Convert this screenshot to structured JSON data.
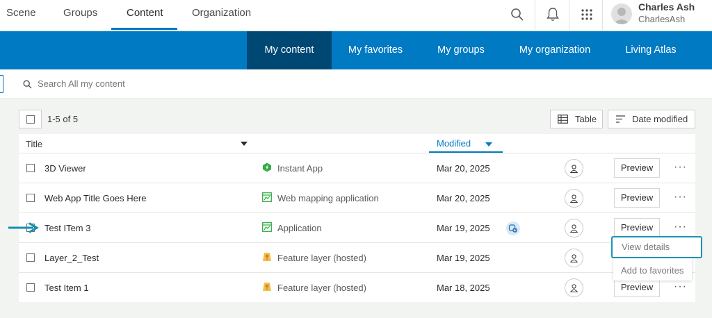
{
  "top_nav": {
    "tabs": [
      {
        "label": "Scene",
        "active": false
      },
      {
        "label": "Groups",
        "active": false
      },
      {
        "label": "Content",
        "active": true
      },
      {
        "label": "Organization",
        "active": false
      }
    ],
    "user": {
      "name": "Charles Ash",
      "username": "CharlesAsh"
    },
    "icons": [
      "search-icon",
      "bell-icon",
      "app-launcher-icon"
    ]
  },
  "content_nav": {
    "tabs": [
      {
        "label": "My content",
        "active": true
      },
      {
        "label": "My favorites",
        "active": false
      },
      {
        "label": "My groups",
        "active": false
      },
      {
        "label": "My organization",
        "active": false
      },
      {
        "label": "Living Atlas",
        "active": false
      }
    ]
  },
  "search": {
    "placeholder": "Search All my content"
  },
  "toolbar": {
    "count": "1-5 of 5",
    "view_label": "Table",
    "sort_label": "Date modified"
  },
  "table": {
    "headers": {
      "title": "Title",
      "modified": "Modified"
    },
    "rows": [
      {
        "title": "3D Viewer",
        "type": "Instant App",
        "type_icon": "instant-app-icon",
        "modified": "Mar 20, 2025",
        "preview": "Preview"
      },
      {
        "title": "Web App Title Goes Here",
        "type": "Web mapping application",
        "type_icon": "web-mapping-app-icon",
        "modified": "Mar 20, 2025",
        "preview": "Preview"
      },
      {
        "title": "Test ITem 3",
        "type": "Application",
        "type_icon": "application-icon",
        "modified": "Mar 19, 2025",
        "preview": "Preview",
        "shared_badge": true
      },
      {
        "title": "Layer_2_Test",
        "type": "Feature layer (hosted)",
        "type_icon": "feature-layer-icon",
        "modified": "Mar 19, 2025",
        "preview": "Preview"
      },
      {
        "title": "Test Item 1",
        "type": "Feature layer (hosted)",
        "type_icon": "feature-layer-icon",
        "modified": "Mar 18, 2025",
        "preview": "Preview"
      }
    ]
  },
  "context_menu": {
    "items": [
      "View details",
      "Add to favorites"
    ]
  },
  "colors": {
    "accent": "#007ac2",
    "active_tab": "#004874",
    "highlight": "#1894b5",
    "pointer_arrow": "#138fae"
  }
}
